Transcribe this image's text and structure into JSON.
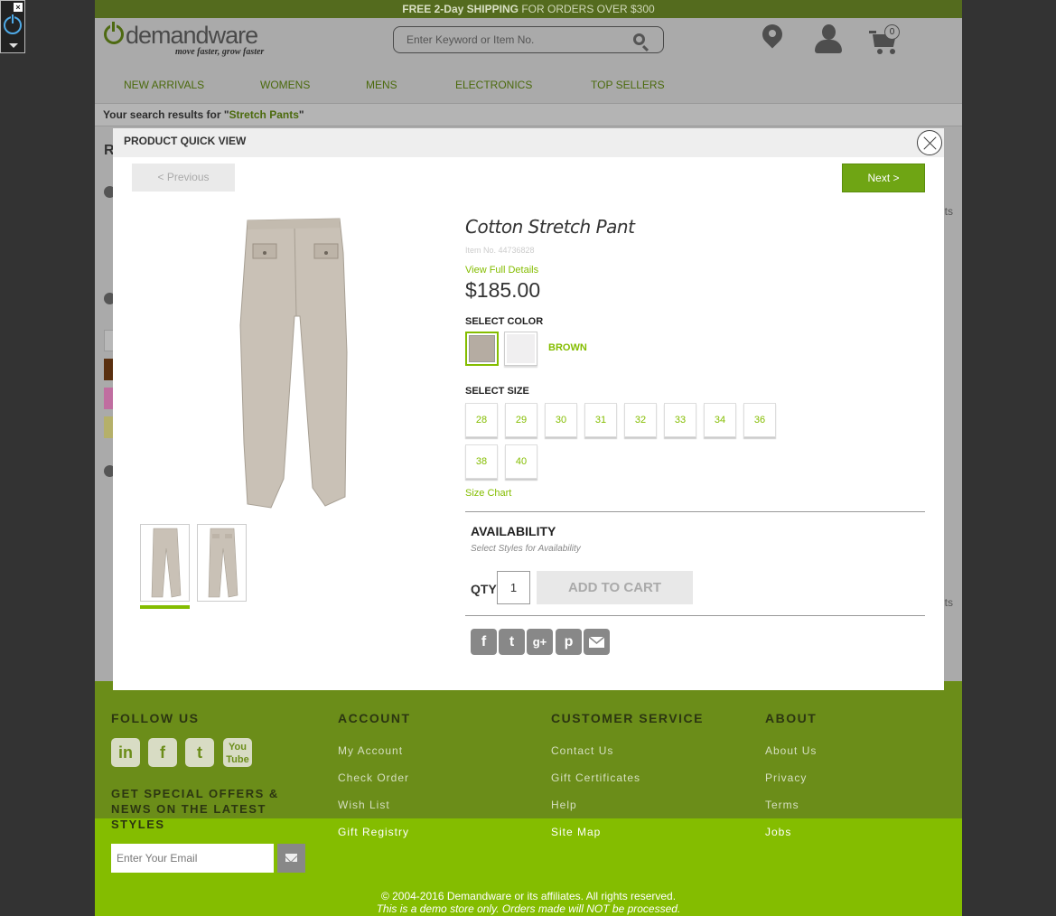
{
  "promo": {
    "strong": "FREE 2-Day SHIPPING",
    "rest": " FOR ORDERS OVER $300"
  },
  "header": {
    "logo_word": "demandware",
    "logo_tagline": "move faster, grow faster",
    "search_placeholder": "Enter Keyword or Item No.",
    "cart_count": "0"
  },
  "nav": [
    "NEW ARRIVALS",
    "WOMENS",
    "MENS",
    "ELECTRONICS",
    "TOP SELLERS"
  ],
  "search_results": {
    "prefix": "Your search results for \"",
    "term": "Stretch Pants",
    "suffix": "\""
  },
  "quick_view": {
    "title": "PRODUCT QUICK VIEW",
    "prev_label": "< Previous",
    "next_label": "Next >",
    "product_name": "Cotton Stretch Pant",
    "item_no": "Item No. 44736828",
    "view_full_details": "View Full Details",
    "price": "$185.00",
    "select_color_label": "SELECT COLOR",
    "selected_color": "BROWN",
    "select_size_label": "SELECT SIZE",
    "sizes": [
      "28",
      "29",
      "30",
      "31",
      "32",
      "33",
      "34",
      "36",
      "38",
      "40"
    ],
    "size_chart": "Size Chart",
    "availability_label": "AVAILABILITY",
    "availability_sub": "Select Styles for Availability",
    "qty_label": "QTY",
    "qty_value": "1",
    "add_to_cart": "ADD TO CART",
    "share_icons": [
      "facebook-icon",
      "twitter-icon",
      "google-plus-icon",
      "pinterest-icon",
      "email-icon"
    ],
    "colors": {
      "accent": "#84bd00",
      "swatch_brown": "#b5aca2",
      "swatch_white": "#f0eff0"
    }
  },
  "footer": {
    "follow_us": "FOLLOW US",
    "social_icons": [
      "linkedin-icon",
      "facebook-icon",
      "twitter-icon",
      "youtube-icon"
    ],
    "offers_heading": "GET SPECIAL OFFERS & NEWS ON THE LATEST STYLES",
    "email_placeholder": "Enter Your Email",
    "account": {
      "heading": "ACCOUNT",
      "links": [
        "My Account",
        "Check Order",
        "Wish List",
        "Gift Registry"
      ]
    },
    "customer_service": {
      "heading": "CUSTOMER SERVICE",
      "links": [
        "Contact Us",
        "Gift Certificates",
        "Help",
        "Site Map"
      ]
    },
    "about": {
      "heading": "ABOUT",
      "links": [
        "About Us",
        "Privacy",
        "Terms",
        "Jobs"
      ]
    },
    "copyright": "© 2004-2016 Demandware or its affiliates. All rights reserved.",
    "demo_notice": "This is a demo store only. Orders made will NOT be processed."
  },
  "background_fragments": {
    "refine_letter": "R",
    "results_suffix_1": "lts",
    "results_suffix_2": "lts"
  }
}
